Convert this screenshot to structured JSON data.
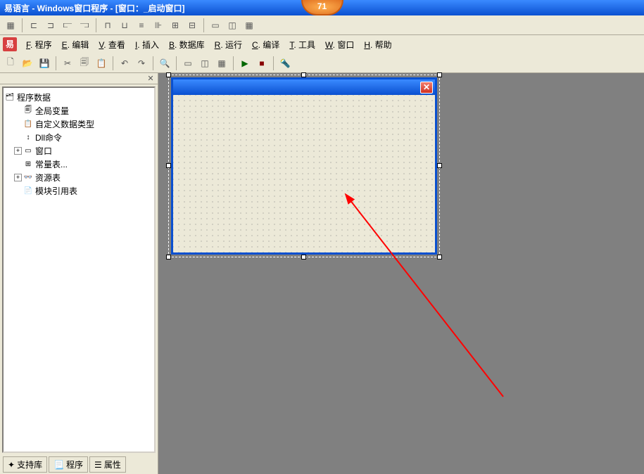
{
  "title": "易语言 - Windows窗口程序 - [窗口：_启动窗口]",
  "badge": "71",
  "menu": [
    {
      "key": "F",
      "label": "程序"
    },
    {
      "key": "E",
      "label": "编辑"
    },
    {
      "key": "V",
      "label": "查看"
    },
    {
      "key": "I",
      "label": "插入"
    },
    {
      "key": "B",
      "label": "数据库"
    },
    {
      "key": "R",
      "label": "运行"
    },
    {
      "key": "C",
      "label": "编译"
    },
    {
      "key": "T",
      "label": "工具"
    },
    {
      "key": "W",
      "label": "窗口"
    },
    {
      "key": "H",
      "label": "帮助"
    }
  ],
  "tree": {
    "root": "程序数据",
    "items": [
      {
        "label": "全局变量",
        "icon": "🗐"
      },
      {
        "label": "自定义数据类型",
        "icon": "📋"
      },
      {
        "label": "Dll命令",
        "icon": "↕"
      },
      {
        "label": "窗口",
        "icon": "▭",
        "expandable": true
      },
      {
        "label": "常量表...",
        "icon": "⊞"
      },
      {
        "label": "资源表",
        "icon": "👓",
        "expandable": true
      },
      {
        "label": "模块引用表",
        "icon": "📄"
      }
    ]
  },
  "sideTabs": [
    {
      "label": "支持库",
      "icon": "✦"
    },
    {
      "label": "程序",
      "icon": "📃"
    },
    {
      "label": "属性",
      "icon": "☰"
    }
  ],
  "toolbarIcons2": [
    "◧",
    "◨",
    "—",
    "≡",
    "≡",
    "◫"
  ],
  "toolbarIcons3": [
    "▭",
    "◫",
    "▦",
    "",
    "▶",
    "■",
    "",
    "🔍"
  ]
}
